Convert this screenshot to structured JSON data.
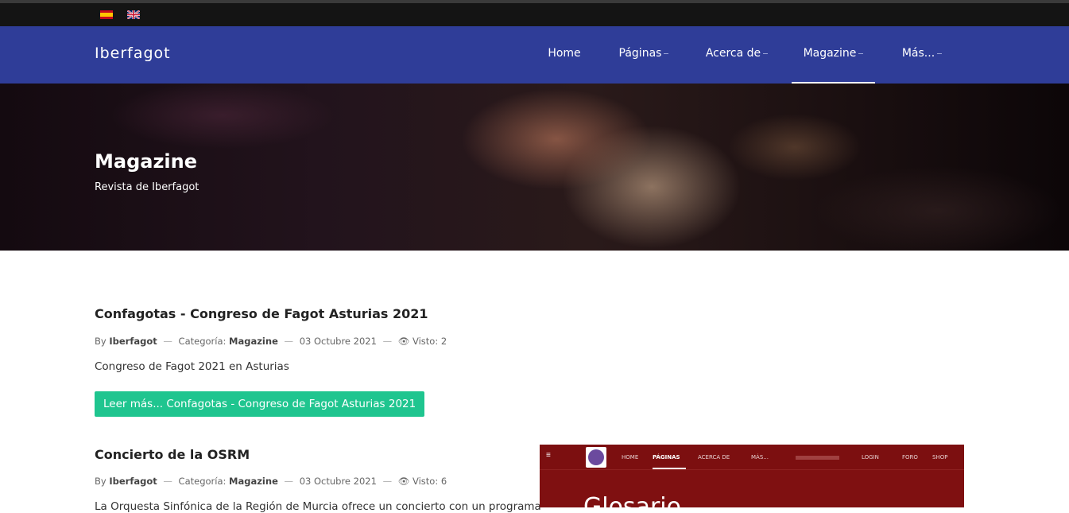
{
  "topbar": {
    "languages": [
      {
        "code": "es",
        "icon": "spain-flag-icon"
      },
      {
        "code": "en",
        "icon": "uk-flag-icon"
      }
    ]
  },
  "navbar": {
    "brand": "Iberfagot",
    "items": [
      {
        "label": "Home",
        "has_dropdown": false,
        "active": false
      },
      {
        "label": "Páginas",
        "has_dropdown": true,
        "active": false
      },
      {
        "label": "Acerca de",
        "has_dropdown": true,
        "active": false
      },
      {
        "label": "Magazine",
        "has_dropdown": true,
        "active": true
      },
      {
        "label": "Más...",
        "has_dropdown": true,
        "active": false
      }
    ],
    "color": "#2f3d98"
  },
  "hero": {
    "title": "Magazine",
    "subtitle": "Revista de Iberfagot"
  },
  "articles": [
    {
      "title": "Confagotas - Congreso de Fagot Asturias 2021",
      "by_label": "By",
      "author": "Iberfagot",
      "category_label": "Categoría:",
      "category": "Magazine",
      "date": "03 Octubre 2021",
      "views_label": "Visto: 2",
      "views_icon": "eye-icon",
      "excerpt": "Congreso de Fagot 2021 en Asturias",
      "read_more": "Leer más... Confagotas - Congreso de Fagot Asturias 2021"
    },
    {
      "title": "Concierto de la OSRM",
      "by_label": "By",
      "author": "Iberfagot",
      "category_label": "Categoría:",
      "category": "Magazine",
      "date": "03 Octubre 2021",
      "views_label": "Visto: 6",
      "views_icon": "eye-icon",
      "excerpt": "La Orquesta Sinfónica de la Región de Murcia ofrece un concierto con un programa"
    }
  ],
  "thumbnail": {
    "menu_icon": "hamburger-icon",
    "nav": [
      "HOME",
      "PÁGINAS",
      "ACERCA DE",
      "MÁS...",
      "LOGIN",
      "FORO",
      "SHOP"
    ],
    "heading": "Glosario",
    "background": "#7f1011"
  },
  "colors": {
    "button": "#1fc58f",
    "topbar": "#141414"
  }
}
